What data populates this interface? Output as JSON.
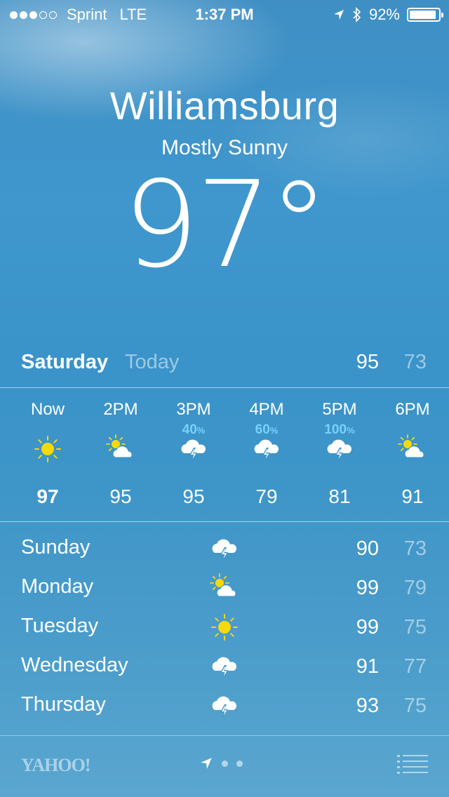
{
  "status_bar": {
    "carrier": "Sprint",
    "network": "LTE",
    "time": "1:37 PM",
    "battery": "92%",
    "battery_level": 0.92,
    "signal_strength": 3,
    "signal_max": 5
  },
  "header": {
    "city": "Williamsburg",
    "condition": "Mostly Sunny",
    "temperature": "97°"
  },
  "today": {
    "day": "Saturday",
    "label": "Today",
    "high": "95",
    "low": "73"
  },
  "hourly": [
    {
      "time": "Now",
      "precip": "",
      "icon": "sun-icon",
      "temp": "97"
    },
    {
      "time": "2PM",
      "precip": "",
      "icon": "partly-cloudy-icon",
      "temp": "95"
    },
    {
      "time": "3PM",
      "precip": "40",
      "icon": "thunderstorm-icon",
      "temp": "95"
    },
    {
      "time": "4PM",
      "precip": "60",
      "icon": "thunderstorm-icon",
      "temp": "79"
    },
    {
      "time": "5PM",
      "precip": "100",
      "icon": "thunderstorm-icon",
      "temp": "81"
    },
    {
      "time": "6PM",
      "precip": "",
      "icon": "partly-cloudy-icon",
      "temp": "91"
    }
  ],
  "percent_sign": "%",
  "daily": [
    {
      "day": "Sunday",
      "icon": "thunderstorm-icon",
      "high": "90",
      "low": "73"
    },
    {
      "day": "Monday",
      "icon": "partly-cloudy-icon",
      "high": "99",
      "low": "79"
    },
    {
      "day": "Tuesday",
      "icon": "sun-icon",
      "high": "99",
      "low": "75"
    },
    {
      "day": "Wednesday",
      "icon": "thunderstorm-icon",
      "high": "91",
      "low": "77"
    },
    {
      "day": "Thursday",
      "icon": "thunderstorm-icon",
      "high": "93",
      "low": "75"
    }
  ],
  "footer": {
    "logo": "YAHOO!",
    "page_dots": 2
  },
  "colors": {
    "sun": "#f5d90a",
    "precip": "#7ad0ff"
  }
}
